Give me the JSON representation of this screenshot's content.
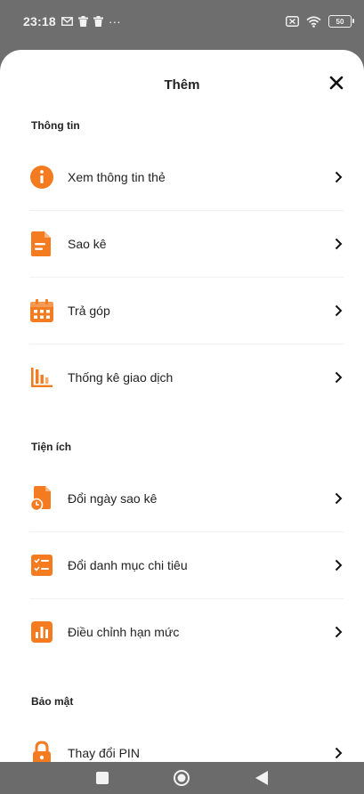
{
  "status_bar": {
    "time": "23:18",
    "dots": "···",
    "battery": "50"
  },
  "sheet": {
    "title": "Thêm"
  },
  "sections": [
    {
      "title": "Thông tin",
      "items": [
        {
          "label": "Xem thông tin thẻ",
          "icon": "info-icon"
        },
        {
          "label": "Sao kê",
          "icon": "document-icon"
        },
        {
          "label": "Trả góp",
          "icon": "calendar-icon"
        },
        {
          "label": "Thống kê giao dịch",
          "icon": "bar-chart-icon"
        }
      ]
    },
    {
      "title": "Tiện ích",
      "items": [
        {
          "label": "Đổi ngày sao kê",
          "icon": "document-clock-icon"
        },
        {
          "label": "Đổi danh mục chi tiêu",
          "icon": "checklist-icon"
        },
        {
          "label": "Điều chỉnh hạn mức",
          "icon": "chart-box-icon"
        }
      ]
    },
    {
      "title": "Bảo mật",
      "items": [
        {
          "label": "Thay đổi PIN",
          "icon": "lock-icon"
        }
      ]
    }
  ],
  "colors": {
    "accent": "#F47B20",
    "status_bar": "#6E6E6E",
    "nav_bar": "#6B6B6B"
  }
}
